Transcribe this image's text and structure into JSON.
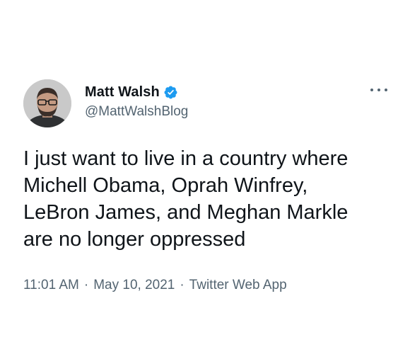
{
  "author": {
    "name": "Matt Walsh",
    "handle": "@MattWalshBlog",
    "verified": true,
    "verified_color": "#1d9bf0"
  },
  "tweet": {
    "text": "I just want to live in a country where\nMichell Obama, Oprah Winfrey,\nLeBron James, and Meghan Markle\nare no longer oppressed",
    "time": "11:01 AM",
    "date": "May 10, 2021",
    "source": "Twitter Web App",
    "separator": "·"
  },
  "icons": {
    "more": "more-options-icon",
    "verified": "verified-badge-icon"
  }
}
